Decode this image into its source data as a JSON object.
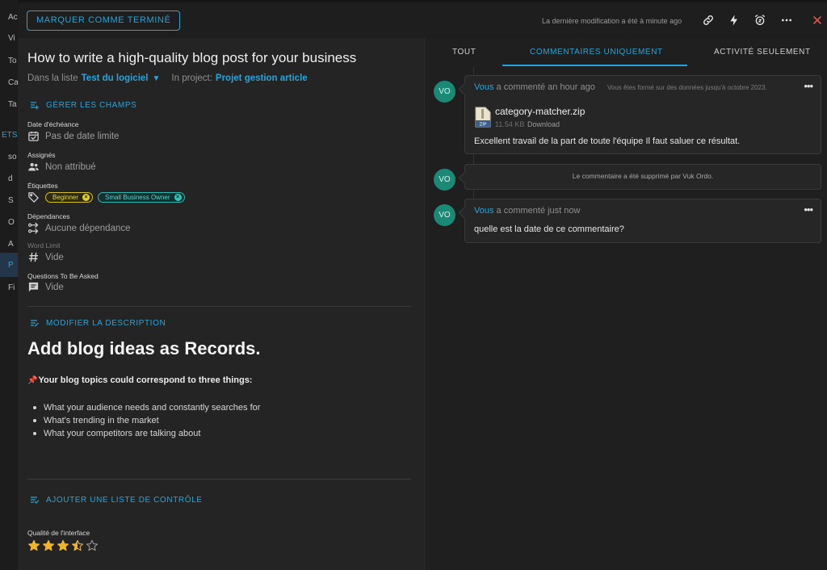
{
  "bg_sidebar": {
    "items": [
      "Ac",
      "Vi",
      "To",
      "Ca",
      "Ta",
      "ETS C",
      "so",
      "d",
      "S",
      "O",
      "A",
      "P",
      "Fi"
    ]
  },
  "topbar": {
    "done_label": "MARQUER COMME TERMINÉ",
    "last_modified": "La dernière modification a été à minute ago",
    "icons": [
      "link-icon",
      "bolt-icon",
      "alarm-clock-icon",
      "more-icon",
      "close-icon"
    ]
  },
  "task": {
    "title": "How to write a high-quality blog post for your business",
    "list_prefix": "Dans la liste",
    "list_name": "Test du logiciel",
    "project_prefix": "In project:",
    "project_name": "Projet gestion article"
  },
  "fields": {
    "manage_label": "GÉRER LES CHAMPS",
    "due_label": "Date d'échéance",
    "due_value": "Pas de date limite",
    "assigned_label": "Assignés",
    "assigned_value": "Non attribué",
    "tags_label": "Étiquettes",
    "tags": [
      "Beginner",
      "Small Business Owner"
    ],
    "deps_label": "Dépendances",
    "deps_value": "Aucune dépendance",
    "wordlimit_label": "Word Limit",
    "wordlimit_value": "Vide",
    "questions_label": "Questions To Be Asked",
    "questions_value": "Vide"
  },
  "description": {
    "edit_label": "MODIFIER LA DESCRIPTION",
    "heading": "Add blog ideas as Records.",
    "subheading": "Your blog topics could correspond to three things:",
    "bullets": [
      "What your audience needs and constantly searches for",
      "What's trending in the market",
      "What your competitors are talking about"
    ]
  },
  "checklist": {
    "add_label": "AJOUTER UNE LISTE DE CONTRÔLE"
  },
  "rating": {
    "label": "Qualité de l'interface",
    "value": 3.5,
    "max": 5,
    "color": "#f0b429"
  },
  "activity": {
    "tabs": [
      "TOUT",
      "COMMENTAIRES UNIQUEMENT",
      "ACTIVITÉ SEULEMENT"
    ],
    "active_tab": 1,
    "comments": [
      {
        "avatar": "VO",
        "author": "Vous",
        "action": "a commenté an hour ago",
        "note": "Vous êtes formé sur des données jusqu'à octobre 2023.",
        "file_name": "category-matcher.zip",
        "file_ext": "ZIP",
        "file_size": "11.54 KB",
        "file_action": "Download",
        "text": "Excellent travail de la part de toute l'équipe Il faut saluer ce résultat."
      },
      {
        "avatar": "VO",
        "deleted_text": "Le commentaire a été supprimé par Vuk Ordo."
      },
      {
        "avatar": "VO",
        "author": "Vous",
        "action": "a commenté just now",
        "text": "quelle est la date de ce commentaire?"
      }
    ],
    "more_glyph": "•••"
  },
  "colors": {
    "accent": "#29a3d6",
    "avatar": "#1a8a76",
    "close": "#e05252"
  }
}
